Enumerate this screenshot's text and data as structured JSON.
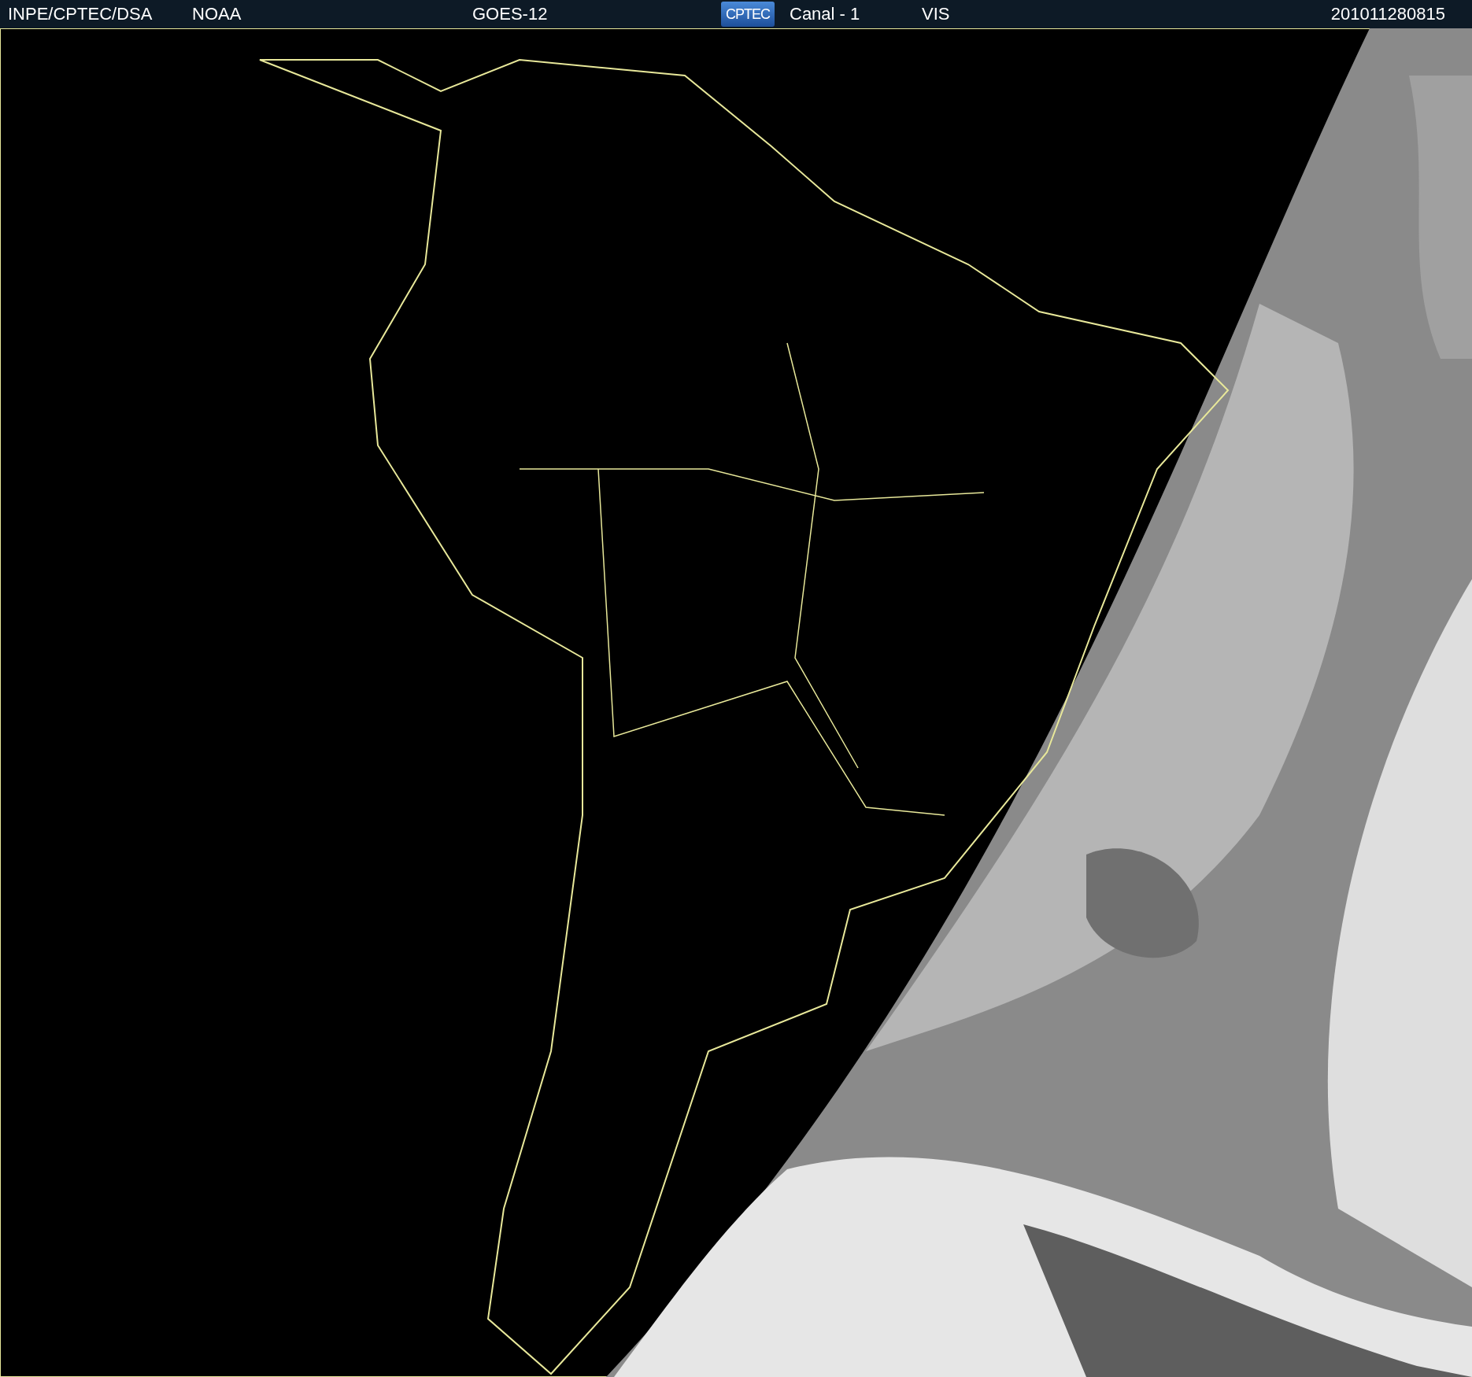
{
  "header": {
    "agency": "INPE/CPTEC/DSA",
    "source": "NOAA",
    "satellite": "GOES-12",
    "logo": "CPTEC",
    "channel": "Canal - 1",
    "band": "VIS",
    "timestamp": "201011280815"
  }
}
